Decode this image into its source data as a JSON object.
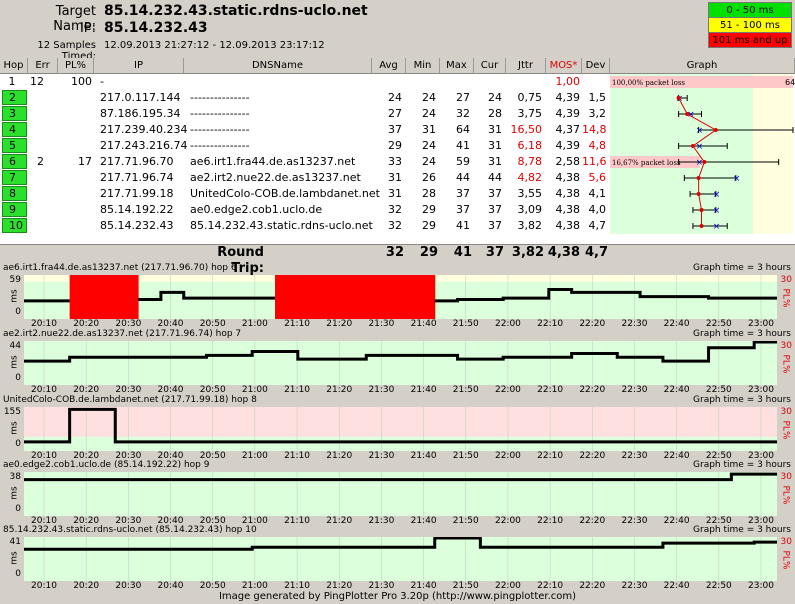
{
  "header": {
    "target_label": "Target Name:",
    "target_value": "85.14.232.43.static.rdns-uclo.net",
    "ip_label": "IP:",
    "ip_value": "85.14.232.43",
    "samples_label": "12 Samples Timed:",
    "samples_value": "12.09.2013 21:27:12 - 12.09.2013 23:17:12"
  },
  "legend": [
    {
      "label": "0 - 50 ms",
      "color": "#00e000"
    },
    {
      "label": "51 - 100 ms",
      "color": "#ffff00"
    },
    {
      "label": "101 ms and up",
      "color": "#ff0000"
    }
  ],
  "columns": [
    "Hop",
    "Err",
    "PL%",
    "IP",
    "DNSName",
    "Avg",
    "Min",
    "Max",
    "Cur",
    "Jttr",
    "MOS*",
    "Dev",
    "Graph"
  ],
  "rows": [
    {
      "hop": "1",
      "err": "12",
      "pl": "100",
      "ip": "-",
      "dns": "",
      "avg": "",
      "min": "",
      "max": "",
      "cur": "",
      "jttr": "",
      "mos": "1,00",
      "dev": "",
      "pl_label": "100,00% packet loss",
      "graph_max": "64"
    },
    {
      "hop": "2",
      "err": "",
      "pl": "",
      "ip": "217.0.117.144",
      "dns": "---------------",
      "avg": "24",
      "min": "24",
      "max": "27",
      "cur": "24",
      "jttr": "0,75",
      "mos": "4,39",
      "dev": "1,5"
    },
    {
      "hop": "3",
      "err": "",
      "pl": "",
      "ip": "87.186.195.34",
      "dns": "---------------",
      "avg": "27",
      "min": "24",
      "max": "32",
      "cur": "28",
      "jttr": "3,75",
      "mos": "4,39",
      "dev": "3,2"
    },
    {
      "hop": "4",
      "err": "",
      "pl": "",
      "ip": "217.239.40.234",
      "dns": "---------------",
      "avg": "37",
      "min": "31",
      "max": "64",
      "cur": "31",
      "jttr": "16,50",
      "mos": "4,37",
      "dev": "14,8"
    },
    {
      "hop": "5",
      "err": "",
      "pl": "",
      "ip": "217.243.216.74",
      "dns": "---------------",
      "avg": "29",
      "min": "24",
      "max": "41",
      "cur": "31",
      "jttr": "6,18",
      "mos": "4,39",
      "dev": "4,8"
    },
    {
      "hop": "6",
      "err": "2",
      "pl": "17",
      "ip": "217.71.96.70",
      "dns": "ae6.irt1.fra44.de.as13237.net",
      "avg": "33",
      "min": "24",
      "max": "59",
      "cur": "31",
      "jttr": "8,78",
      "mos": "2,58",
      "dev": "11,6",
      "pl_label": "16,67% packet loss"
    },
    {
      "hop": "7",
      "err": "",
      "pl": "",
      "ip": "217.71.96.74",
      "dns": "ae2.irt2.nue22.de.as13237.net",
      "avg": "31",
      "min": "26",
      "max": "44",
      "cur": "44",
      "jttr": "4,82",
      "mos": "4,38",
      "dev": "5,6"
    },
    {
      "hop": "8",
      "err": "",
      "pl": "",
      "ip": "217.71.99.18",
      "dns": "UnitedColo-COB.de.lambdanet.net",
      "avg": "31",
      "min": "28",
      "max": "37",
      "cur": "37",
      "jttr": "3,55",
      "mos": "4,38",
      "dev": "4,1"
    },
    {
      "hop": "9",
      "err": "",
      "pl": "",
      "ip": "85.14.192.22",
      "dns": "ae0.edge2.cob1.uclo.de",
      "avg": "32",
      "min": "29",
      "max": "37",
      "cur": "37",
      "jttr": "3,09",
      "mos": "4,38",
      "dev": "4,0"
    },
    {
      "hop": "10",
      "err": "",
      "pl": "",
      "ip": "85.14.232.43",
      "dns": "85.14.232.43.static.rdns-uclo.net",
      "avg": "32",
      "min": "29",
      "max": "41",
      "cur": "37",
      "jttr": "3,82",
      "mos": "4,38",
      "dev": "4,7"
    }
  ],
  "roundtrip": {
    "label": "Round Trip:",
    "avg": "32",
    "min": "29",
    "max": "41",
    "cur": "37",
    "jttr": "3,82",
    "mos": "4,38",
    "dev": "4,7"
  },
  "hop_graphs": [
    {
      "title": "ae6.irt1.fra44.de.as13237.net (217.71.96.70) hop 6",
      "time": "Graph time = 3 hours",
      "ymax": "59",
      "ymid": "ms",
      "y0": "0",
      "pl_top": "30",
      "pl_label": "PL%",
      "values": [
        24,
        24,
        null,
        null,
        null,
        26,
        36,
        28,
        28,
        28,
        28,
        null,
        null,
        null,
        null,
        null,
        null,
        null,
        24,
        26,
        26,
        28,
        28,
        40,
        36,
        36,
        36,
        30,
        30,
        30,
        28,
        28,
        28
      ],
      "loss": [
        0,
        0,
        1,
        1,
        1,
        0,
        0,
        0,
        0,
        0,
        0,
        1,
        1,
        1,
        1,
        1,
        1,
        1,
        0,
        0,
        0,
        0,
        0,
        0,
        0,
        0,
        0,
        0,
        0,
        0,
        0,
        0,
        0
      ]
    },
    {
      "title": "ae2.irt2.nue22.de.as13237.net (217.71.96.74) hop 7",
      "time": "Graph time = 3 hours",
      "ymax": "44",
      "ymid": "ms",
      "y0": "0",
      "pl_top": "30",
      "pl_label": "PL%",
      "values": [
        24,
        24,
        28,
        28,
        28,
        28,
        28,
        28,
        30,
        30,
        34,
        34,
        26,
        26,
        26,
        30,
        30,
        30,
        30,
        26,
        26,
        28,
        28,
        28,
        32,
        32,
        28,
        28,
        24,
        24,
        38,
        38,
        44
      ],
      "loss": []
    },
    {
      "title": "UnitedColo-COB.de.lambdanet.net (217.71.99.18) hop 8",
      "time": "Graph time = 3 hours",
      "ymax": "155",
      "ymid": "ms",
      "y0": "0",
      "pl_top": "30",
      "pl_label": "PL%",
      "values": [
        30,
        30,
        150,
        150,
        30,
        30,
        30,
        30,
        30,
        30,
        30,
        30,
        30,
        30,
        30,
        30,
        30,
        30,
        30,
        30,
        30,
        30,
        30,
        30,
        30,
        30,
        30,
        30,
        30,
        30,
        30,
        30,
        30
      ],
      "loss": []
    },
    {
      "title": "ae0.edge2.cob1.uclo.de (85.14.192.22) hop 9",
      "time": "Graph time = 3 hours",
      "ymax": "38",
      "ymid": "ms",
      "y0": "0",
      "pl_top": "30",
      "pl_label": "PL%",
      "values": [
        32,
        32,
        32,
        32,
        32,
        32,
        32,
        32,
        32,
        32,
        32,
        32,
        32,
        32,
        32,
        32,
        32,
        32,
        32,
        32,
        32,
        32,
        32,
        32,
        32,
        32,
        32,
        32,
        32,
        32,
        32,
        37,
        37
      ],
      "loss": []
    },
    {
      "title": "85.14.232.43.static.rdns-uclo.net (85.14.232.43) hop 10",
      "time": "Graph time = 3 hours",
      "ymax": "41",
      "ymid": "ms",
      "y0": "0",
      "pl_top": "30",
      "pl_label": "PL%",
      "values": [
        30,
        30,
        30,
        30,
        30,
        30,
        30,
        30,
        30,
        30,
        32,
        32,
        32,
        32,
        32,
        32,
        32,
        32,
        41,
        41,
        32,
        32,
        32,
        32,
        32,
        32,
        32,
        32,
        36,
        36,
        36,
        36,
        37
      ],
      "loss": []
    }
  ],
  "time_ticks": [
    "20:10",
    "20:20",
    "20:30",
    "20:40",
    "20:50",
    "21:00",
    "21:10",
    "21:20",
    "21:30",
    "21:40",
    "21:50",
    "22:00",
    "22:10",
    "22:20",
    "22:30",
    "22:40",
    "22:50",
    "23:00"
  ],
  "footer": "Image generated by PingPlotter Pro 3.20p (http://www.pingplotter.com)"
}
